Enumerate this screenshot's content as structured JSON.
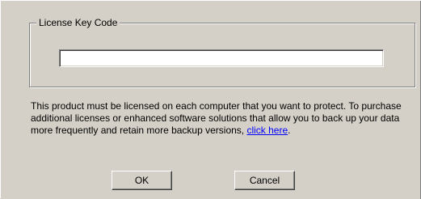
{
  "license_group": {
    "title": "License Key Code",
    "key_value": "",
    "key_placeholder": ""
  },
  "info": {
    "message": "This product must be licensed on each computer that you want to protect. To purchase additional licenses or enhanced software solutions that allow you to back up your data more frequently and retain more backup versions, ",
    "link_text": "click here",
    "trailing": "."
  },
  "buttons": {
    "ok_label": "OK",
    "cancel_label": "Cancel"
  },
  "colors": {
    "dialog_bg": "#d4d0c8",
    "link": "#0000ff",
    "input_bg": "#ffffff"
  }
}
